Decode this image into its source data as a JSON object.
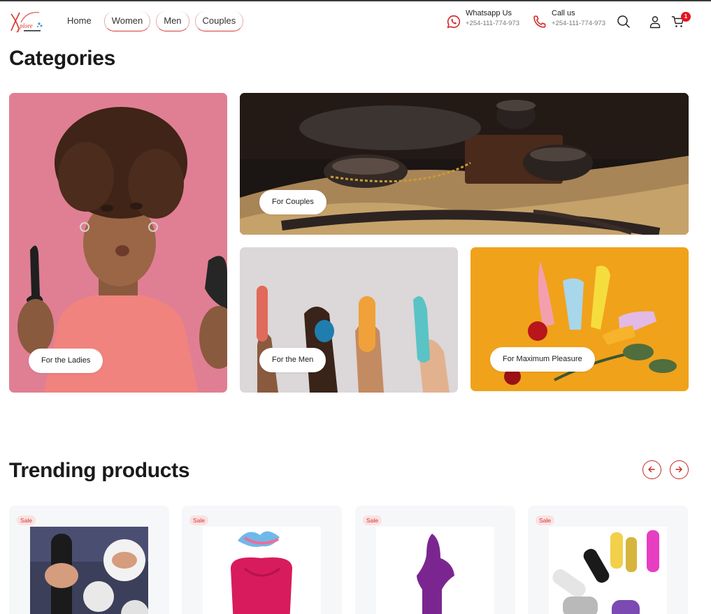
{
  "header": {
    "nav": [
      "Home",
      "Women",
      "Men",
      "Couples"
    ],
    "whatsapp": {
      "title": "Whatsapp Us",
      "phone": "+254-111-774-973"
    },
    "call": {
      "title": "Call us",
      "phone": "+254-111-774-973"
    },
    "cart_count": "1",
    "icons": [
      "search-icon",
      "user-icon",
      "cart-icon",
      "whatsapp-icon",
      "phone-icon"
    ]
  },
  "categories": {
    "title": "Categories",
    "cards": [
      {
        "label": "For the Ladies"
      },
      {
        "label": "For Couples"
      },
      {
        "label": "For the Men"
      },
      {
        "label": "For Maximum Pleasure"
      }
    ]
  },
  "trending": {
    "title": "Trending products",
    "products": [
      {
        "badge": "Sale"
      },
      {
        "badge": "Sale"
      },
      {
        "badge": "Sale"
      },
      {
        "badge": "Sale"
      }
    ]
  },
  "colors": {
    "accent": "#d32f2f",
    "badge": "#e4151f",
    "sale_bg": "#fbe1e1"
  }
}
